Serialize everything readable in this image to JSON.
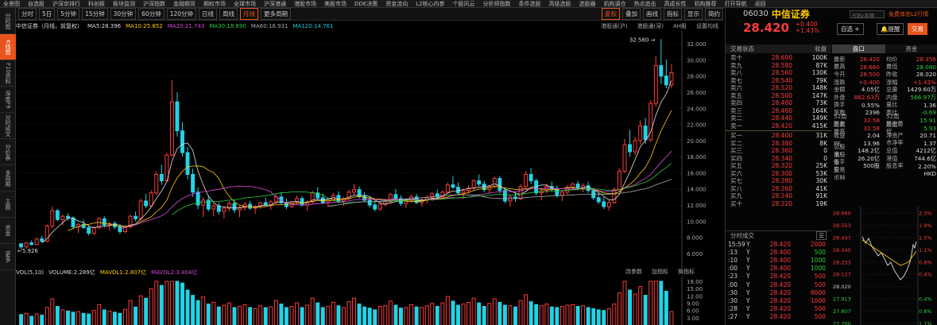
{
  "top_menu": [
    "全景图",
    "自选股",
    "沪深京排行",
    "科创板",
    "板块监测",
    "沪深指数",
    "金融期货",
    "期权市场",
    "全球市场",
    "沪深港通",
    "港股市场",
    "美股市场",
    "DDE决策",
    "资金流向",
    "L2核心内参",
    "个股风云",
    "分析师指数",
    "条件选股",
    "高级选股",
    "选股器",
    "机构调仓",
    "热点追击",
    "高成长性",
    "机构推荐",
    "打开导航",
    "返回"
  ],
  "sidebar": [
    "分时图",
    "K线图",
    "F10资料",
    "深度F9",
    "分时成交",
    "分价表",
    "多周期",
    "主题",
    "资金",
    "更多"
  ],
  "sidebar_active": 1,
  "toolbar": {
    "periods": [
      "分时",
      "5日",
      "5分钟",
      "15分钟",
      "30分钟",
      "60分钟",
      "120分钟",
      "日线",
      "周线",
      "月线",
      "更多周期"
    ],
    "active_period": 9,
    "right": [
      "复权",
      "叠加",
      "画线",
      "指标",
      "显示",
      "简约"
    ]
  },
  "ma_bar": {
    "title": "中信证券（月线，前复权）",
    "ma5": "MA5:28.396",
    "ma10": "MA10:25.852",
    "ma20": "MA20:21.743",
    "ma30": "MA30:18.890",
    "ma60": "MA60:16.931",
    "ma120": "MA120:14.761",
    "right": [
      "港股通(沪)",
      "港股通(深)",
      "AH股",
      "设置均线"
    ]
  },
  "vol_bar": {
    "vol": "VOL(5,10)",
    "volume": "VOLUME:2.289亿",
    "mavol1": "MAVOL1:2.807亿",
    "mavol2": "MAVOL2:3.404亿",
    "right": [
      "改参数",
      "加指标",
      "换指标"
    ]
  },
  "chart_data": {
    "type": "candlestick",
    "price_axis": [
      "32.000",
      "30.000",
      "28.000",
      "26.000",
      "24.000",
      "22.000",
      "20.000",
      "18.000",
      "16.000",
      "14.000",
      "12.000",
      "10.000",
      "8.000",
      "6.000"
    ],
    "vol_axis": [
      "18.00",
      "15.00",
      "12.00",
      "9.00",
      "6.00",
      "3.00"
    ],
    "ylim": [
      5,
      33
    ],
    "max_label": "32.580",
    "min_label": "5.926",
    "candles": [
      [
        7.2,
        7.0,
        6.5,
        6.8
      ],
      [
        6.8,
        7.4,
        6.6,
        7.3
      ],
      [
        7.3,
        7.6,
        7.0,
        7.1
      ],
      [
        7.1,
        7.9,
        7.0,
        7.8
      ],
      [
        7.8,
        8.2,
        7.3,
        7.5
      ],
      [
        7.5,
        9.6,
        7.4,
        9.4
      ],
      [
        9.4,
        11.8,
        9.1,
        11.3
      ],
      [
        11.3,
        11.5,
        10.0,
        10.2
      ],
      [
        10.2,
        10.8,
        9.5,
        10.6
      ],
      [
        10.6,
        11.0,
        10.1,
        10.4
      ],
      [
        10.4,
        10.6,
        9.0,
        9.3
      ],
      [
        9.3,
        9.8,
        8.5,
        9.6
      ],
      [
        9.6,
        10.2,
        9.0,
        9.2
      ],
      [
        9.2,
        9.5,
        8.2,
        8.5
      ],
      [
        8.5,
        9.4,
        8.3,
        9.2
      ],
      [
        9.2,
        10.5,
        9.0,
        10.3
      ],
      [
        10.3,
        10.6,
        9.2,
        9.5
      ],
      [
        9.5,
        9.9,
        8.8,
        9.7
      ],
      [
        9.7,
        10.0,
        9.0,
        9.3
      ],
      [
        9.3,
        9.6,
        8.4,
        8.7
      ],
      [
        8.7,
        9.5,
        8.5,
        9.3
      ],
      [
        9.3,
        10.8,
        9.1,
        10.6
      ],
      [
        10.6,
        11.2,
        10.0,
        10.3
      ],
      [
        10.3,
        12.8,
        10.1,
        12.5
      ],
      [
        12.5,
        13.4,
        11.6,
        11.9
      ],
      [
        11.9,
        13.8,
        11.7,
        13.5
      ],
      [
        13.5,
        16.2,
        13.2,
        15.8
      ],
      [
        15.8,
        17.0,
        14.5,
        15.0
      ],
      [
        15.0,
        18.5,
        14.8,
        18.2
      ],
      [
        18.2,
        27.5,
        18.0,
        24.8
      ],
      [
        24.8,
        26.0,
        20.5,
        21.2
      ],
      [
        21.2,
        22.3,
        18.0,
        18.5
      ],
      [
        18.5,
        19.2,
        15.2,
        15.8
      ],
      [
        15.8,
        16.5,
        13.0,
        13.6
      ],
      [
        13.6,
        14.2,
        11.5,
        12.0
      ],
      [
        12.0,
        13.0,
        10.5,
        12.6
      ],
      [
        12.6,
        13.2,
        11.2,
        11.5
      ],
      [
        11.5,
        12.2,
        10.6,
        11.9
      ],
      [
        11.9,
        12.3,
        10.8,
        11.2
      ],
      [
        11.2,
        11.8,
        10.3,
        11.6
      ],
      [
        11.6,
        12.5,
        11.2,
        12.2
      ],
      [
        12.2,
        12.6,
        11.0,
        11.4
      ],
      [
        11.4,
        11.9,
        10.5,
        11.7
      ],
      [
        11.7,
        12.4,
        11.3,
        12.1
      ],
      [
        12.1,
        12.5,
        11.4,
        11.6
      ],
      [
        11.6,
        12.0,
        10.9,
        11.8
      ],
      [
        11.8,
        12.4,
        11.5,
        12.3
      ],
      [
        12.3,
        12.9,
        11.8,
        12.0
      ],
      [
        12.0,
        12.6,
        11.4,
        12.4
      ],
      [
        12.4,
        13.3,
        12.2,
        13.0
      ],
      [
        13.0,
        13.6,
        12.0,
        12.3
      ],
      [
        12.3,
        12.8,
        11.5,
        11.8
      ],
      [
        11.8,
        12.5,
        11.6,
        12.4
      ],
      [
        12.4,
        13.2,
        12.1,
        12.8
      ],
      [
        12.8,
        13.1,
        11.8,
        12.0
      ],
      [
        12.0,
        12.6,
        11.3,
        12.4
      ],
      [
        12.4,
        13.8,
        12.2,
        13.5
      ],
      [
        13.5,
        14.2,
        12.6,
        12.9
      ],
      [
        12.9,
        13.4,
        12.1,
        12.3
      ],
      [
        12.3,
        12.9,
        11.8,
        12.7
      ],
      [
        12.7,
        13.5,
        12.5,
        13.2
      ],
      [
        13.2,
        13.7,
        12.2,
        12.5
      ],
      [
        12.5,
        13.0,
        11.9,
        12.8
      ],
      [
        12.8,
        13.9,
        12.6,
        13.6
      ],
      [
        13.6,
        14.6,
        13.2,
        13.9
      ],
      [
        13.9,
        14.3,
        12.8,
        13.1
      ],
      [
        13.1,
        13.6,
        12.4,
        12.6
      ],
      [
        12.6,
        13.1,
        11.7,
        12.0
      ],
      [
        12.0,
        12.5,
        11.2,
        11.5
      ],
      [
        11.5,
        12.3,
        11.3,
        12.1
      ],
      [
        12.1,
        12.8,
        11.8,
        12.4
      ],
      [
        12.4,
        13.5,
        12.2,
        13.3
      ],
      [
        13.3,
        14.0,
        12.6,
        12.8
      ],
      [
        12.8,
        13.2,
        11.9,
        12.2
      ],
      [
        12.2,
        12.7,
        11.6,
        12.5
      ],
      [
        12.5,
        13.3,
        12.3,
        13.0
      ],
      [
        13.0,
        13.4,
        12.1,
        12.3
      ],
      [
        12.3,
        12.9,
        11.8,
        12.6
      ],
      [
        12.6,
        13.2,
        12.2,
        12.9
      ],
      [
        12.9,
        13.6,
        12.5,
        13.4
      ],
      [
        13.4,
        13.9,
        12.7,
        13.0
      ],
      [
        13.0,
        13.8,
        12.8,
        13.6
      ],
      [
        13.6,
        14.8,
        13.4,
        14.5
      ],
      [
        14.5,
        15.6,
        14.0,
        14.2
      ],
      [
        14.2,
        14.8,
        13.2,
        13.5
      ],
      [
        13.5,
        14.0,
        12.8,
        13.8
      ],
      [
        13.8,
        14.5,
        13.4,
        14.1
      ],
      [
        14.1,
        15.2,
        13.8,
        15.0
      ],
      [
        15.0,
        15.8,
        14.3,
        14.6
      ],
      [
        14.6,
        15.0,
        13.6,
        13.9
      ],
      [
        13.9,
        14.5,
        13.4,
        14.3
      ],
      [
        14.3,
        15.5,
        14.1,
        15.3
      ],
      [
        15.3,
        15.6,
        13.5,
        13.8
      ],
      [
        13.8,
        14.2,
        12.2,
        12.5
      ],
      [
        12.5,
        13.3,
        11.8,
        13.0
      ],
      [
        13.0,
        13.6,
        12.4,
        12.8
      ],
      [
        12.8,
        14.6,
        12.6,
        14.3
      ],
      [
        14.3,
        16.2,
        14.1,
        15.8
      ],
      [
        15.8,
        16.6,
        14.6,
        15.0
      ],
      [
        15.0,
        15.3,
        13.2,
        13.5
      ],
      [
        13.5,
        14.0,
        12.6,
        13.8
      ],
      [
        13.8,
        14.6,
        13.5,
        14.3
      ],
      [
        14.3,
        14.9,
        13.7,
        14.0
      ],
      [
        14.0,
        14.4,
        12.9,
        13.2
      ],
      [
        13.2,
        13.8,
        12.5,
        13.6
      ],
      [
        13.6,
        14.5,
        13.3,
        14.2
      ],
      [
        14.2,
        14.8,
        13.9,
        14.6
      ],
      [
        14.6,
        15.0,
        13.8,
        14.1
      ],
      [
        14.1,
        14.7,
        13.6,
        14.4
      ],
      [
        14.4,
        14.9,
        13.5,
        13.8
      ],
      [
        13.8,
        14.1,
        12.6,
        12.9
      ],
      [
        12.9,
        13.4,
        12.1,
        12.4
      ],
      [
        12.4,
        13.0,
        11.5,
        11.8
      ],
      [
        11.8,
        12.6,
        11.3,
        12.3
      ],
      [
        12.3,
        14.2,
        12.1,
        13.9
      ],
      [
        13.9,
        16.5,
        13.7,
        16.2
      ],
      [
        16.2,
        20.2,
        16.0,
        19.5
      ],
      [
        19.5,
        21.3,
        18.0,
        18.6
      ],
      [
        18.6,
        20.5,
        18.2,
        20.0
      ],
      [
        20.0,
        22.5,
        19.5,
        21.8
      ],
      [
        21.8,
        22.8,
        19.6,
        20.1
      ],
      [
        20.1,
        25.0,
        19.8,
        24.6
      ],
      [
        24.6,
        30.5,
        24.2,
        29.3
      ],
      [
        29.3,
        32.58,
        27.0,
        28.0
      ],
      [
        28.0,
        30.0,
        26.5,
        26.9
      ],
      [
        26.9,
        29.5,
        26.5,
        28.42
      ]
    ],
    "volumes": [
      1.8,
      2.0,
      1.5,
      1.9,
      1.7,
      3.0,
      4.5,
      3.2,
      2.6,
      2.4,
      2.2,
      2.3,
      2.0,
      1.9,
      2.5,
      3.5,
      2.6,
      2.4,
      2.2,
      2.0,
      2.7,
      4.2,
      3.1,
      5.0,
      4.6,
      6.2,
      8.1,
      6.8,
      9.5,
      14.8,
      9.3,
      7.2,
      6.0,
      5.1,
      4.2,
      4.8,
      3.6,
      3.9,
      3.1,
      3.4,
      3.8,
      3.0,
      3.2,
      3.5,
      3.0,
      2.8,
      3.3,
      3.0,
      3.1,
      4.2,
      3.6,
      3.0,
      3.2,
      3.8,
      3.0,
      3.4,
      4.6,
      3.8,
      3.0,
      3.2,
      3.9,
      3.3,
      3.0,
      4.0,
      4.6,
      3.6,
      3.1,
      2.9,
      2.6,
      3.2,
      3.3,
      4.1,
      3.4,
      2.9,
      3.0,
      3.5,
      3.1,
      3.0,
      3.3,
      3.7,
      3.2,
      3.8,
      4.9,
      4.1,
      3.4,
      3.6,
      3.9,
      4.6,
      3.8,
      3.2,
      3.7,
      4.5,
      3.9,
      3.4,
      3.3,
      3.1,
      4.2,
      5.2,
      4.0,
      3.5,
      3.3,
      3.6,
      3.1,
      3.0,
      3.2,
      3.4,
      3.5,
      3.2,
      3.3,
      3.0,
      2.8,
      2.6,
      2.5,
      2.8,
      3.6,
      5.5,
      8.2,
      6.0,
      5.3,
      6.6,
      5.1,
      8.9,
      12.6,
      9.3,
      5.8,
      2.3
    ]
  },
  "stock": {
    "code": "06030",
    "name": "中信证券",
    "price": "28.420",
    "change": "+0.400",
    "pct": "+1.43%",
    "search_placeholder": "代码/名称",
    "free_btn": "免费体验L2行情",
    "self_btn": "自选",
    "warn_btn": "提醒",
    "trade_btn": "交易"
  },
  "orderbook": {
    "head_left": "交易状态",
    "head_right": "收盘",
    "asks": [
      [
        "卖十",
        "28.600",
        "100K"
      ],
      [
        "卖九",
        "28.580",
        "87K"
      ],
      [
        "卖八",
        "28.560",
        "130K"
      ],
      [
        "卖七",
        "28.540",
        "79K"
      ],
      [
        "卖六",
        "28.520",
        "148K"
      ],
      [
        "卖五",
        "28.500",
        "147K"
      ],
      [
        "卖四",
        "28.480",
        "73K"
      ],
      [
        "卖三",
        "28.460",
        "164K"
      ],
      [
        "卖二",
        "28.440",
        "149K"
      ],
      [
        "卖一",
        "28.420",
        "415K"
      ]
    ],
    "bids": [
      [
        "买一",
        "28.400",
        "31K"
      ],
      [
        "买二",
        "28.380",
        "8K"
      ],
      [
        "买三",
        "28.360",
        "0"
      ],
      [
        "买四",
        "28.340",
        "0"
      ],
      [
        "买五",
        "28.320",
        "25K"
      ],
      [
        "买六",
        "28.300",
        "53K"
      ],
      [
        "买七",
        "28.280",
        "30K"
      ],
      [
        "买八",
        "28.260",
        "41K"
      ],
      [
        "买九",
        "28.240",
        "91K"
      ],
      [
        "买十",
        "28.220",
        "19K"
      ]
    ]
  },
  "stats_tabs": [
    "盘口",
    "资金"
  ],
  "stats": [
    [
      "最新",
      "28.420",
      "red",
      "均价",
      "28.356",
      "red"
    ],
    [
      "最高",
      "28.660",
      "red",
      "最低",
      "28.080",
      "green"
    ],
    [
      "今开",
      "28.500",
      "red",
      "昨收",
      "28.020",
      "white"
    ],
    [
      "涨跌",
      "+0.400",
      "red",
      "涨幅",
      "+1.43%",
      "red"
    ],
    [
      "金额",
      "4.05亿",
      "white",
      "总量",
      "1429.60万",
      "white"
    ],
    [
      "外盘",
      "862.63万",
      "red",
      "内盘",
      "566.97万",
      "green"
    ],
    [
      "换手",
      "0.55%",
      "white",
      "量比",
      "1.36",
      "white"
    ],
    [
      "笔数",
      "2396",
      "white",
      "委比",
      "-0.69",
      "green"
    ],
    [
      "52周最高",
      "32.58",
      "red",
      "52周最低",
      "15.91",
      "green"
    ],
    [
      "历史最高",
      "32.58",
      "red",
      "历史最低",
      "5.93",
      "green"
    ],
    [
      "收益",
      "2.04",
      "white",
      "净资产",
      "20.71",
      "white"
    ],
    [
      "PE",
      "13.96",
      "white",
      "市净率",
      "1.37",
      "white"
    ],
    [
      "总股本",
      "148.2亿",
      "white",
      "总值",
      "4212亿",
      "white"
    ],
    [
      "港股本",
      "26.20亿",
      "white",
      "港值",
      "744.6亿",
      "white"
    ],
    [
      "每手股",
      "500股",
      "white",
      "股息率",
      "2.20%",
      "white"
    ],
    [
      "交易币种",
      "",
      "white",
      "",
      "HKD",
      "white"
    ]
  ],
  "ticks": {
    "head": "分时成交",
    "rows": [
      [
        "15:59",
        "Y",
        "28.420",
        "2000",
        "red"
      ],
      [
        ":13",
        "Y",
        "28.400",
        "500",
        "green"
      ],
      [
        ":10",
        "Y",
        "28.400",
        "1000",
        "green"
      ],
      [
        ":00",
        "Y",
        "28.400",
        "1000",
        "green"
      ],
      [
        ":23",
        "Y",
        "28.420",
        "500",
        "red"
      ],
      [
        ":00",
        "Y",
        "28.420",
        "500",
        "red"
      ],
      [
        ":30",
        "Y",
        "28.420",
        "8000",
        "red"
      ],
      [
        ":30",
        "Y",
        "28.420",
        "1000",
        "red"
      ],
      [
        ":28",
        "Y",
        "28.420",
        "500",
        "red"
      ],
      [
        ":27",
        "Y",
        "28.420",
        "500",
        "red"
      ]
    ]
  },
  "mini_axis": {
    "left": [
      "28.660",
      "28.553",
      "28.447",
      "28.340",
      "28.233",
      "28.127",
      "28.020",
      "27.913",
      "27.807",
      "27.700"
    ],
    "right": [
      "2.3%",
      "1.9%",
      "1.5%",
      "1.1%",
      "0.8%",
      "0.4%",
      "",
      "0.4%",
      "0.8%",
      "1.1%"
    ]
  }
}
